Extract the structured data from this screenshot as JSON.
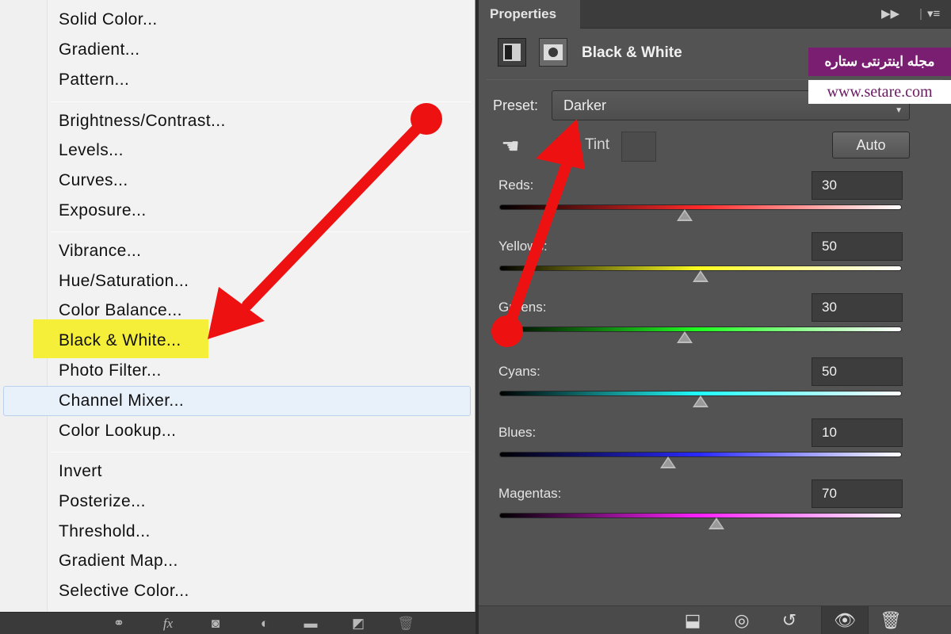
{
  "menu": {
    "groups": [
      [
        "Solid Color...",
        "Gradient...",
        "Pattern..."
      ],
      [
        "Brightness/Contrast...",
        "Levels...",
        "Curves...",
        "Exposure..."
      ],
      [
        "Vibrance...",
        "Hue/Saturation...",
        "Color Balance...",
        "Black & White...",
        "Photo Filter...",
        "Channel Mixer...",
        "Color Lookup..."
      ],
      [
        "Invert",
        "Posterize...",
        "Threshold...",
        "Gradient Map...",
        "Selective Color..."
      ]
    ],
    "highlighted_item": "Black & White...",
    "hovered_item": "Channel Mixer...",
    "highlight_color": "#f5ef3a"
  },
  "panel": {
    "tab_label": "Properties",
    "title": "Black & White",
    "preset_label": "Preset:",
    "preset_value": "Darker",
    "tint_label": "Tint",
    "tint_checked": false,
    "auto_label": "Auto",
    "sliders": [
      {
        "label": "Reds:",
        "value": "30",
        "gradient": [
          "#000000",
          "#ff2a2a",
          "#ffffff"
        ],
        "position": 0.46
      },
      {
        "label": "Yellows:",
        "value": "50",
        "gradient": [
          "#000000",
          "#ffff22",
          "#ffffff"
        ],
        "position": 0.5
      },
      {
        "label": "Greens:",
        "value": "30",
        "gradient": [
          "#000000",
          "#22ff22",
          "#ffffff"
        ],
        "position": 0.46
      },
      {
        "label": "Cyans:",
        "value": "50",
        "gradient": [
          "#000000",
          "#22ffff",
          "#ffffff"
        ],
        "position": 0.5
      },
      {
        "label": "Blues:",
        "value": "10",
        "gradient": [
          "#000000",
          "#2a2aff",
          "#ffffff"
        ],
        "position": 0.42
      },
      {
        "label": "Magentas:",
        "value": "70",
        "gradient": [
          "#000000",
          "#ff22ff",
          "#ffffff"
        ],
        "position": 0.54
      }
    ]
  },
  "icons": {
    "panel_header": [
      "expand-icon",
      "panel-menu-icon"
    ],
    "type_icons": [
      "adjustment-layer-icon",
      "layer-mask-icon"
    ],
    "bottom_left": [
      "link-icon",
      "fx-icon",
      "add-mask-icon",
      "adjustment-icon",
      "folder-icon",
      "new-layer-icon",
      "trash-icon"
    ],
    "bottom_right": [
      "clip-to-layer-icon",
      "view-previous-icon",
      "reset-icon",
      "visibility-eye-icon",
      "trash-icon"
    ]
  },
  "watermark": {
    "name": "مجله اینترنتی ستاره",
    "url": "www.setare.com",
    "color": "#7a1e72"
  },
  "annotation_color": "#ee1111"
}
